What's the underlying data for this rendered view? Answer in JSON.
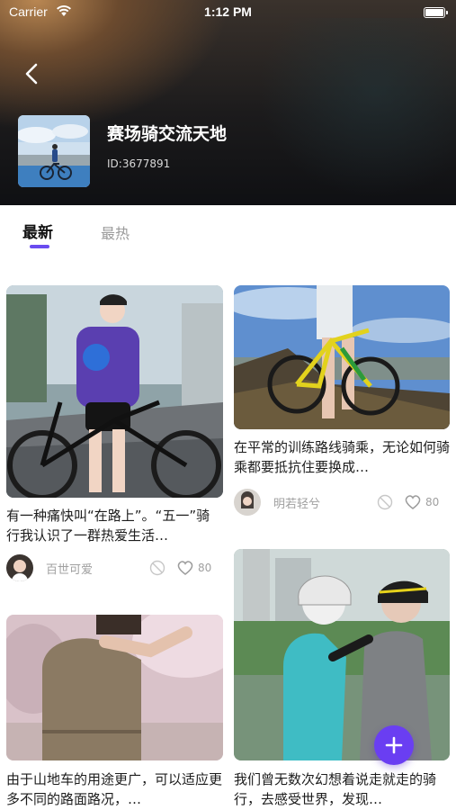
{
  "status_bar": {
    "carrier": "Carrier",
    "time": "1:12 PM"
  },
  "group": {
    "title": "赛场骑交流天地",
    "id_label": "ID:3677891"
  },
  "tabs": [
    {
      "label": "最新",
      "active": true
    },
    {
      "label": "最热",
      "active": false
    }
  ],
  "posts": [
    {
      "text": "有一种痛快叫“在路上”。“五一”骑行我认识了一群热爱生活…",
      "author": "百世可爱",
      "likes": "80"
    },
    {
      "text": "在平常的训练路线骑乘，无论如何骑乘都要抵抗住要换成…",
      "author": "明若轻兮",
      "likes": "80"
    },
    {
      "text": "由于山地车的用途更广，可以适应更多不同的路面路况，…",
      "author": "",
      "likes": ""
    },
    {
      "text": "我们曾无数次幻想着说走就走的骑行，去感受世界，发现…",
      "author": "",
      "likes": ""
    }
  ],
  "colors": {
    "accent": "#6a4cf0",
    "fab": "#6a3ef2",
    "header_dark": "#1c1b1c"
  },
  "icons": [
    "back-icon",
    "wifi-icon",
    "battery-icon",
    "block-icon",
    "heart-icon",
    "plus-icon"
  ]
}
